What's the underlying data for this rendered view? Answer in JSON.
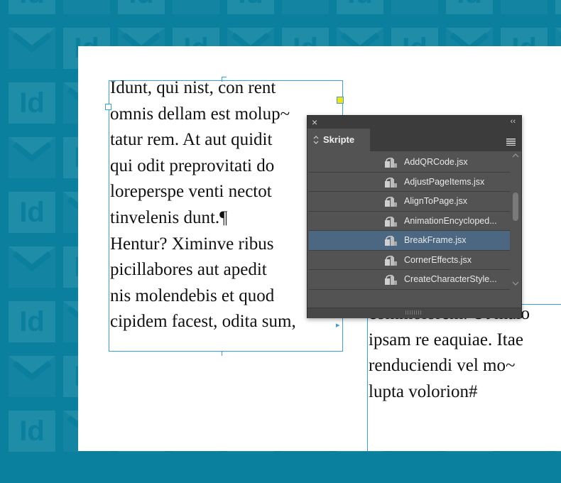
{
  "left_frame": {
    "lines": [
      "Idunt, qui nist, con rent",
      "omnis dellam est molup~",
      "tatur rem. At aut quidit",
      "qui odit preprovitati do",
      "loreperspe venti nectot",
      "tinvelenis dunt.¶",
      "Hentur? Ximinve ribus",
      "picillabores aut apedit",
      "nis molendebis et quod",
      "cipidem facest, odita sum,"
    ]
  },
  "right_frame": {
    "lines": [
      "commolorem. Ut maio",
      "ipsam re eaquiae. Itae",
      "renduciendi vel mo~",
      "lupta volorion#"
    ]
  },
  "panel": {
    "tab_label": "Skripte",
    "close_glyph": "×",
    "collapse_glyph": "‹‹",
    "menu_icon": "hamburger-menu-icon",
    "scripts": [
      {
        "label": "AddQRCode.jsx",
        "selected": false
      },
      {
        "label": "AdjustPageItems.jsx",
        "selected": false
      },
      {
        "label": "AlignToPage.jsx",
        "selected": false
      },
      {
        "label": "AnimationEncycloped...",
        "selected": false
      },
      {
        "label": "BreakFrame.jsx",
        "selected": true
      },
      {
        "label": "CornerEffects.jsx",
        "selected": false
      },
      {
        "label": "CreateCharacterStyle...",
        "selected": false
      }
    ]
  },
  "colors": {
    "background": "#0a7f9e",
    "pattern": "#1f8ca8",
    "frame_edge": "#3aa0dd",
    "panel": "#535353",
    "panel_header": "#3c3c3c",
    "selection": "#4b6781"
  }
}
